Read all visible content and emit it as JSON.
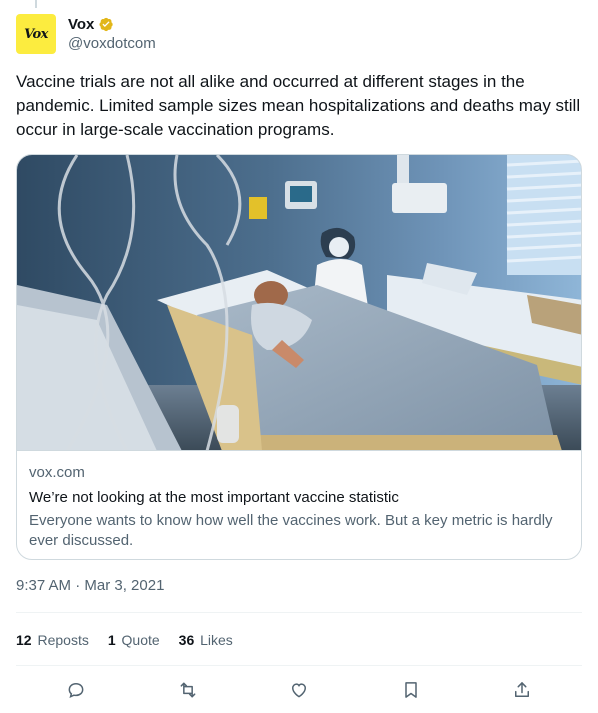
{
  "author": {
    "avatar_text": "Vox",
    "display_name": "Vox",
    "handle": "@voxdotcom",
    "verified_color": "#e2b719"
  },
  "tweet": {
    "text": "Vaccine trials are not all alike and occurred at different stages in the pandemic. Limited sample sizes mean hospitalizations and deaths may still occur in large-scale vaccination programs."
  },
  "card": {
    "domain": "vox.com",
    "title": "We’re not looking at the most important vaccine statistic",
    "description": "Everyone wants to know how well the vaccines work. But a key metric is hardly ever discussed."
  },
  "timestamp": "9:37 AM · Mar 3, 2021",
  "stats": {
    "reposts_count": "12",
    "reposts_label": "Reposts",
    "quotes_count": "1",
    "quotes_label": "Quote",
    "likes_count": "36",
    "likes_label": "Likes"
  },
  "actions": [
    "reply-icon",
    "repost-icon",
    "like-icon",
    "bookmark-icon",
    "share-icon"
  ],
  "colors": {
    "text_primary": "#0f1419",
    "text_secondary": "#536471",
    "border": "#cfd9de",
    "avatar_bg": "#fcec3f"
  }
}
